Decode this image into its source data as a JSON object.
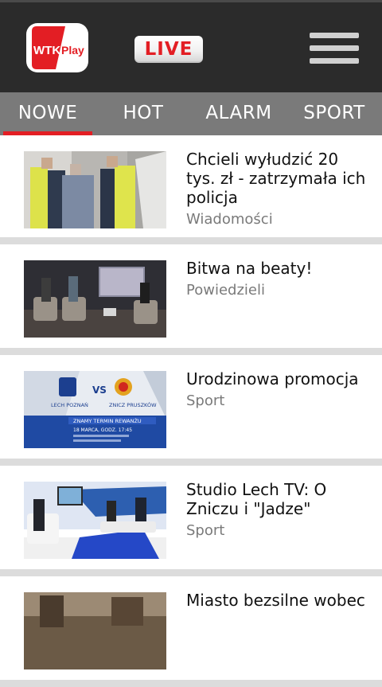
{
  "header": {
    "logo_text": "WTK Play",
    "live_label": "LIVE"
  },
  "tabs": [
    {
      "label": "NOWE",
      "active": true
    },
    {
      "label": "HOT",
      "active": false
    },
    {
      "label": "ALARM",
      "active": false
    },
    {
      "label": "SPORT",
      "active": false
    }
  ],
  "feed": [
    {
      "title": "Chcieli wyłudzić 20 tys. zł - zatrzymała ich policja",
      "category": "Wiadomości"
    },
    {
      "title": "Bitwa na beaty!",
      "category": "Powiedzieli"
    },
    {
      "title": "Urodzinowa promocja",
      "category": "Sport",
      "thumb_text": [
        "LECH POZNAŃ",
        "VS",
        "ZNICZ PRUSZKÓW",
        "ZNAMY TERMIN REWANŻU",
        "18 MARCA, GODZ. 17:45"
      ]
    },
    {
      "title": "Studio Lech TV: O Zniczu i \"Jadze\"",
      "category": "Sport"
    },
    {
      "title": "Miasto bezsilne wobec",
      "category": ""
    }
  ],
  "colors": {
    "header_bg": "#2b2b2b",
    "tab_bar_bg": "#7a7a7a",
    "accent": "#e31e24",
    "category_text": "#7a7a7a"
  }
}
